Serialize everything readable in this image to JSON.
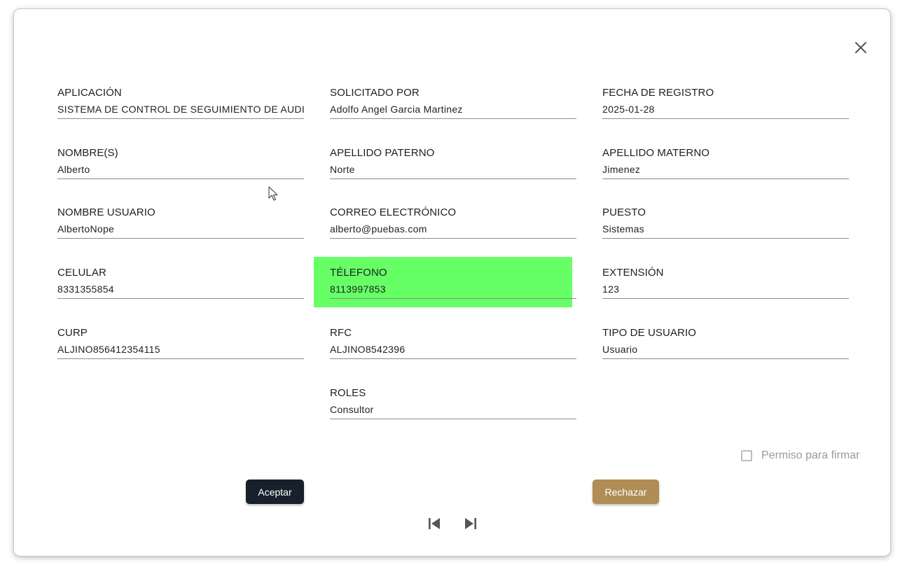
{
  "dialog": {
    "close_icon": "close-icon",
    "fields": {
      "aplicacion": {
        "label": "APLICACIÓN",
        "value": "SISTEMA DE CONTROL DE SEGUIMIENTO DE AUDITORIAS"
      },
      "solicitado_por": {
        "label": "SOLICITADO POR",
        "value": "Adolfo Angel Garcia Martinez"
      },
      "fecha_registro": {
        "label": "FECHA DE REGISTRO",
        "value": "2025-01-28"
      },
      "nombres": {
        "label": "NOMBRE(S)",
        "value": "Alberto"
      },
      "apellido_paterno": {
        "label": "APELLIDO PATERNO",
        "value": "Norte"
      },
      "apellido_materno": {
        "label": "APELLIDO MATERNO",
        "value": "Jimenez"
      },
      "nombre_usuario": {
        "label": "NOMBRE USUARIO",
        "value": "AlbertoNope"
      },
      "correo": {
        "label": "CORREO ELECTRÓNICO",
        "value": "alberto@puebas.com"
      },
      "puesto": {
        "label": "PUESTO",
        "value": "Sistemas"
      },
      "celular": {
        "label": "CELULAR",
        "value": "8331355854"
      },
      "telefono": {
        "label": "TÉLEFONO",
        "value": "8113997853"
      },
      "extension": {
        "label": "EXTENSIÓN",
        "value": "123"
      },
      "curp": {
        "label": "CURP",
        "value": "ALJINO856412354115"
      },
      "rfc": {
        "label": "RFC",
        "value": "ALJINO8542396"
      },
      "tipo_usuario": {
        "label": "TIPO DE USUARIO",
        "value": "Usuario"
      },
      "roles": {
        "label": "ROLES",
        "value": "Consultor"
      }
    },
    "permiso_firmar": {
      "label": "Permiso para firmar",
      "checked": false
    },
    "buttons": {
      "accept": "Aceptar",
      "reject": "Rechazar"
    },
    "pager": {
      "first_icon": "skip-previous-icon",
      "last_icon": "skip-next-icon"
    }
  },
  "colors": {
    "accept_bg": "#17202b",
    "reject_bg": "#b08d55",
    "highlight": "#66ff66"
  }
}
